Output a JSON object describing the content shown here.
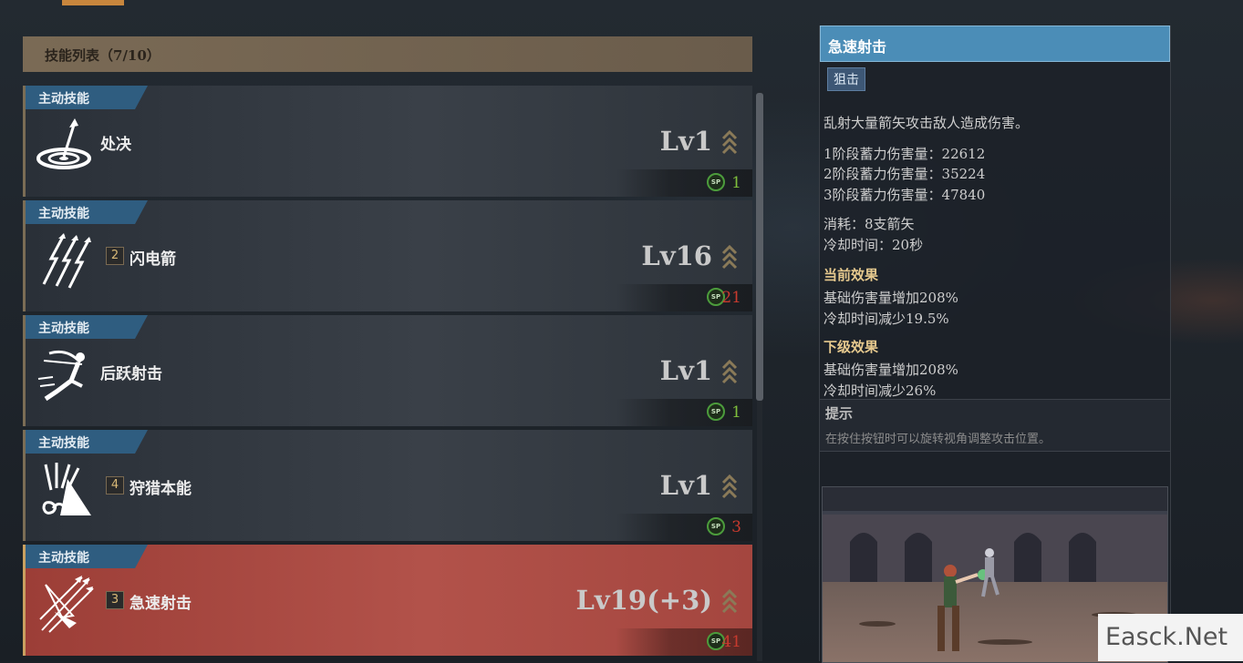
{
  "skill_list": {
    "header": "技能列表（7/10）",
    "skills": [
      {
        "tag": "主动技能",
        "number": "",
        "name": "处决",
        "level": "Lv1",
        "sp": "1",
        "sp_status": "ok",
        "icon": "target-arrow-icon",
        "active": false
      },
      {
        "tag": "主动技能",
        "number": "2",
        "name": "闪电箭",
        "level": "Lv16",
        "sp": "21",
        "sp_status": "insufficient",
        "icon": "lightning-arrows-icon",
        "active": false
      },
      {
        "tag": "主动技能",
        "number": "",
        "name": "后跃射击",
        "level": "Lv1",
        "sp": "1",
        "sp_status": "ok",
        "icon": "backflip-archer-icon",
        "active": false
      },
      {
        "tag": "主动技能",
        "number": "4",
        "name": "狩猎本能",
        "level": "Lv1",
        "sp": "3",
        "sp_status": "insufficient",
        "icon": "hunting-instinct-icon",
        "active": false
      },
      {
        "tag": "主动技能",
        "number": "3",
        "name": "急速射击",
        "level": "Lv19(+3)",
        "sp": "41",
        "sp_status": "insufficient",
        "icon": "rapid-fire-icon",
        "active": true
      }
    ]
  },
  "detail": {
    "title": "急速射击",
    "tag": "狙击",
    "description": "乱射大量箭矢攻击敌人造成伤害。",
    "stats": [
      "1阶段蓄力伤害量：22612",
      "2阶段蓄力伤害量：35224",
      "3阶段蓄力伤害量：47840"
    ],
    "cost": "消耗：8支箭矢",
    "cooldown": "冷却时间：20秒",
    "current_effect": {
      "heading": "当前效果",
      "lines": [
        "基础伤害量增加208%",
        "冷却时间减少19.5%"
      ]
    },
    "next_effect": {
      "heading": "下级效果",
      "lines": [
        "基础伤害量增加208%",
        "冷却时间减少26%"
      ]
    },
    "hint": {
      "heading": "提示",
      "text": "在按住按钮时可以旋转视角调整攻击位置。"
    }
  },
  "sp_label": "SP",
  "watermark": "Easck.Net",
  "colors": {
    "tag_blue": "#2f5d80",
    "title_blue": "#4b8db7",
    "sp_ok": "#7fbf3c",
    "sp_insufficient": "#c83a2e",
    "active_card": "#b2524a"
  }
}
